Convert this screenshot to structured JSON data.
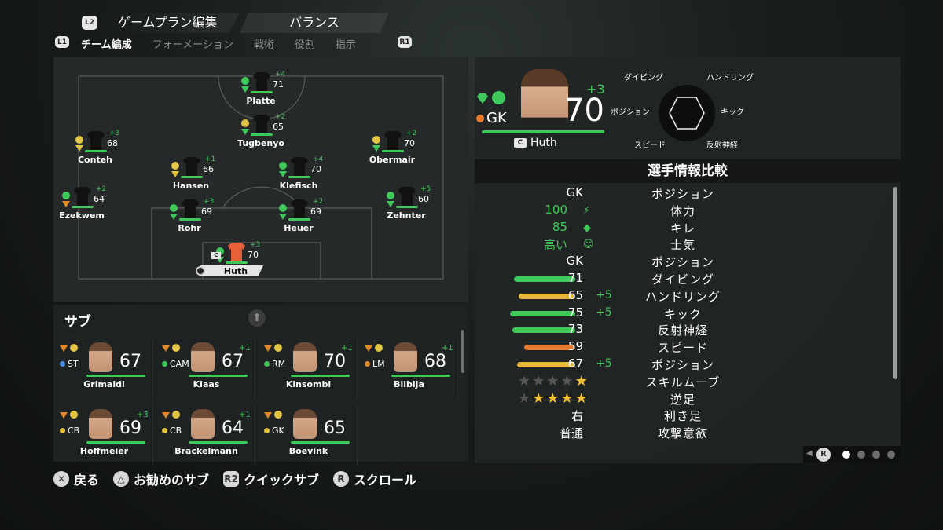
{
  "header": {
    "l2": "L2",
    "title": "ゲームプラン編集",
    "mode": "バランス",
    "l1": "L1",
    "r1": "R1"
  },
  "tabs": [
    {
      "label": "チーム編成",
      "active": true
    },
    {
      "label": "フォーメーション"
    },
    {
      "label": "戦術"
    },
    {
      "label": "役割"
    },
    {
      "label": "指示"
    }
  ],
  "formation": {
    "players": [
      {
        "name": "Platte",
        "rating": "71",
        "plus": "+4",
        "chem": "smile-green",
        "gem": "green"
      },
      {
        "name": "Tugbenyo",
        "rating": "65",
        "plus": "+2",
        "chem": "alert-yellow",
        "gem": "green"
      },
      {
        "name": "Conteh",
        "rating": "68",
        "plus": "+3",
        "chem": "neutral-yellow",
        "gem": "yellow"
      },
      {
        "name": "Obermair",
        "rating": "70",
        "plus": "+2",
        "chem": "neutral-yellow",
        "gem": "green"
      },
      {
        "name": "Hansen",
        "rating": "66",
        "plus": "+1",
        "chem": "neutral-yellow",
        "gem": "yellow"
      },
      {
        "name": "Klefisch",
        "rating": "70",
        "plus": "+4",
        "chem": "smile-green",
        "gem": "green"
      },
      {
        "name": "Ezekwem",
        "rating": "64",
        "plus": "+2",
        "chem": "smile-green",
        "gem": "orange"
      },
      {
        "name": "Zehnter",
        "rating": "60",
        "plus": "+5",
        "chem": "smile-green",
        "gem": "green"
      },
      {
        "name": "Rohr",
        "rating": "69",
        "plus": "+3",
        "chem": "smile-green",
        "gem": "green"
      },
      {
        "name": "Heuer",
        "rating": "69",
        "plus": "+2",
        "chem": "smile-green",
        "gem": "green"
      },
      {
        "name": "Huth",
        "rating": "70",
        "plus": "+3",
        "chem": "smile-green",
        "gem": "green",
        "captain": "C"
      }
    ]
  },
  "subs": {
    "title": "サブ",
    "players": [
      {
        "name": "Grimaldi",
        "pos": "ST",
        "rating": "67",
        "plus": "",
        "poscolor": "#4a8be6"
      },
      {
        "name": "Klaas",
        "pos": "CAM",
        "rating": "67",
        "plus": "+1",
        "poscolor": "#3fc95a"
      },
      {
        "name": "Kinsombi",
        "pos": "RM",
        "rating": "70",
        "plus": "+1",
        "poscolor": "#3fc95a"
      },
      {
        "name": "Bilbija",
        "pos": "LM",
        "rating": "68",
        "plus": "+1",
        "poscolor": "#e08a2c"
      },
      {
        "name": "Hoffmeier",
        "pos": "CB",
        "rating": "69",
        "plus": "+3",
        "poscolor": "#e3c545"
      },
      {
        "name": "Brackelmann",
        "pos": "CB",
        "rating": "64",
        "plus": "+1",
        "poscolor": "#e3c545"
      },
      {
        "name": "Boevink",
        "pos": "GK",
        "rating": "65",
        "plus": "",
        "poscolor": "#e3c545"
      }
    ]
  },
  "detail": {
    "pos": "GK",
    "rating": "70",
    "plus": "+3",
    "name": "Huth",
    "captain": "C",
    "radar": {
      "dive": "ダイビング",
      "handle": "ハンドリング",
      "pos": "ポジション",
      "kick": "キック",
      "speed": "スピード",
      "reflex": "反射神経"
    }
  },
  "compare": {
    "title": "選手情報比較",
    "rows": [
      {
        "left": "GK",
        "label": "ポジション",
        "type": "text"
      },
      {
        "left": "100",
        "label": "体力",
        "type": "green",
        "icon": "bolt-icon"
      },
      {
        "left": "85",
        "label": "キレ",
        "type": "green",
        "icon": "gem-icon"
      },
      {
        "left": "高い",
        "label": "士気",
        "type": "green",
        "icon": "smile-icon"
      },
      {
        "left": "GK",
        "label": "ポジション",
        "type": "text"
      },
      {
        "left": "71",
        "label": "ダイビング",
        "type": "bar",
        "value": 71,
        "color": "#3fc95a",
        "plus": ""
      },
      {
        "left": "65",
        "label": "ハンドリング",
        "type": "bar",
        "value": 65,
        "color": "#e8b83a",
        "plus": "+5"
      },
      {
        "left": "75",
        "label": "キック",
        "type": "bar",
        "value": 75,
        "color": "#3fc95a",
        "plus": "+5"
      },
      {
        "left": "73",
        "label": "反射神経",
        "type": "bar",
        "value": 73,
        "color": "#3fc95a",
        "plus": ""
      },
      {
        "left": "59",
        "label": "スピード",
        "type": "bar",
        "value": 59,
        "color": "#e8782c",
        "plus": ""
      },
      {
        "left": "67",
        "label": "ポジション",
        "type": "bar",
        "value": 67,
        "color": "#e8b83a",
        "plus": "+5"
      },
      {
        "left": "",
        "label": "スキルムーブ",
        "type": "stars",
        "value": 1
      },
      {
        "left": "",
        "label": "逆足",
        "type": "stars",
        "value": 4
      },
      {
        "left": "右",
        "label": "利き足",
        "type": "text"
      },
      {
        "left": "普通",
        "label": "攻撃意欲",
        "type": "text"
      }
    ]
  },
  "pager": {
    "button": "R",
    "pages": 4,
    "active": 1
  },
  "footer": [
    {
      "btn": "✕",
      "label": "戻る"
    },
    {
      "btn": "△",
      "label": "お勧めのサブ"
    },
    {
      "btn": "R2",
      "label": "クイックサブ"
    },
    {
      "btn": "R",
      "label": "スクロール"
    }
  ]
}
